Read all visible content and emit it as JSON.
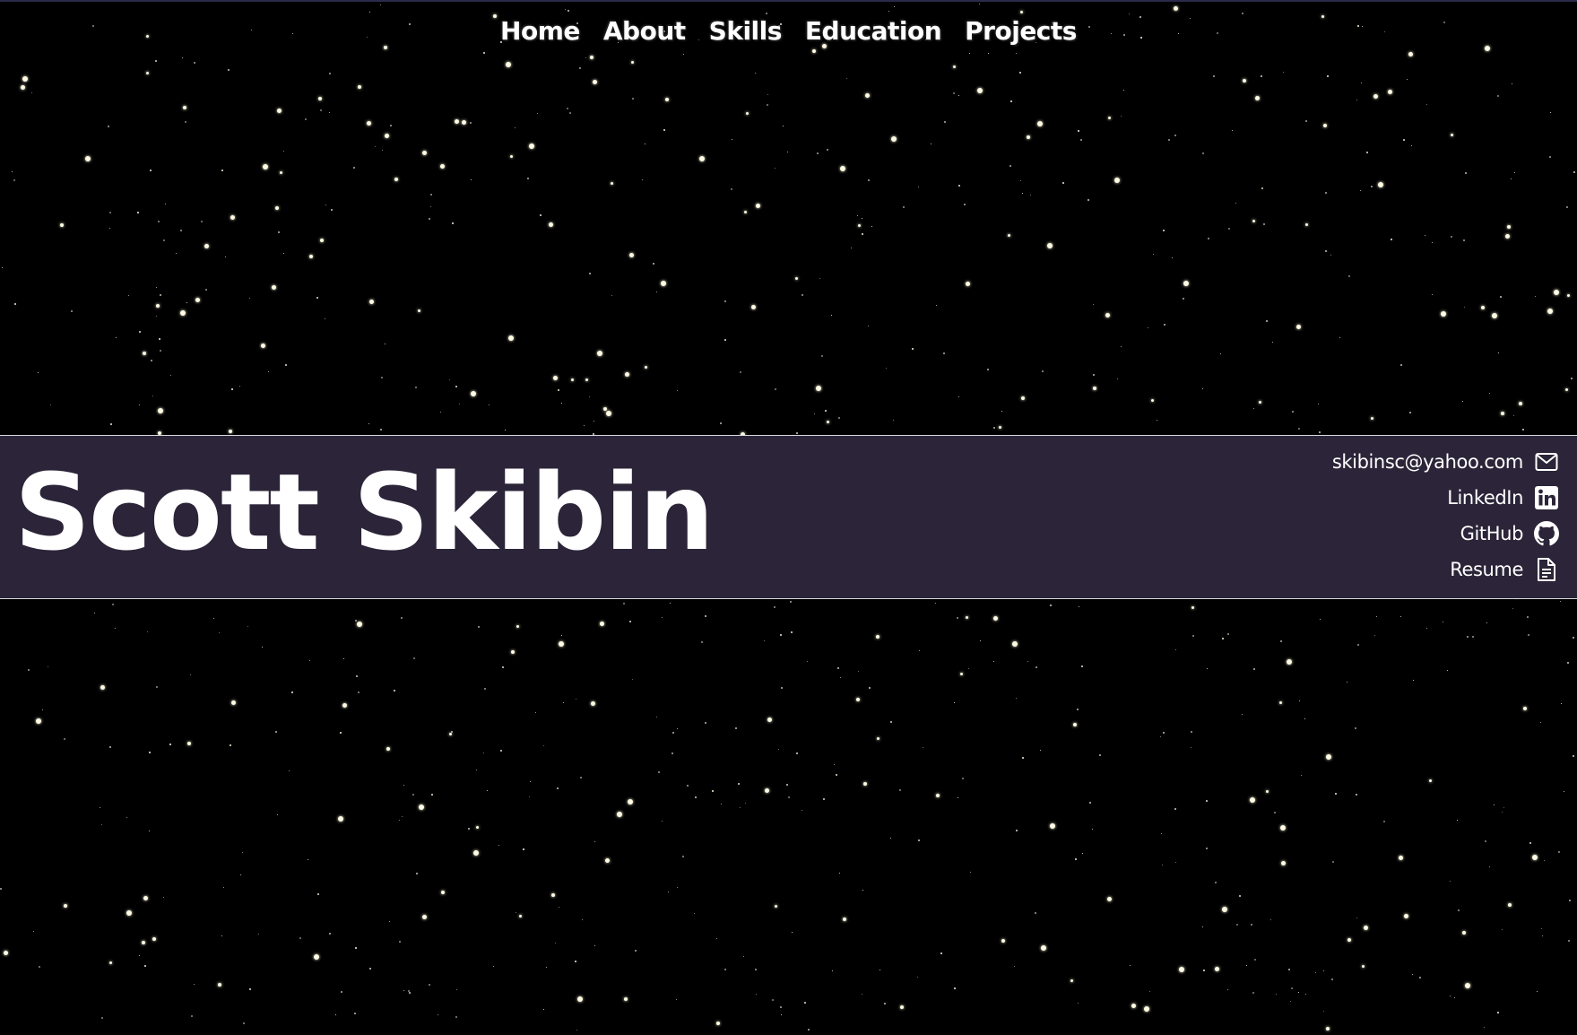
{
  "nav": {
    "items": [
      {
        "label": "Home"
      },
      {
        "label": "About"
      },
      {
        "label": "Skills"
      },
      {
        "label": "Education"
      },
      {
        "label": "Projects"
      }
    ]
  },
  "banner": {
    "name": "Scott Skibin",
    "background_color": "#2c2438"
  },
  "contacts": [
    {
      "label": "skibinsc@yahoo.com",
      "icon": "envelope-icon"
    },
    {
      "label": "LinkedIn",
      "icon": "linkedin-icon"
    },
    {
      "label": "GitHub",
      "icon": "github-icon"
    },
    {
      "label": "Resume",
      "icon": "document-icon"
    }
  ],
  "background": {
    "color": "#000000",
    "star_color": "#fffbe3"
  }
}
